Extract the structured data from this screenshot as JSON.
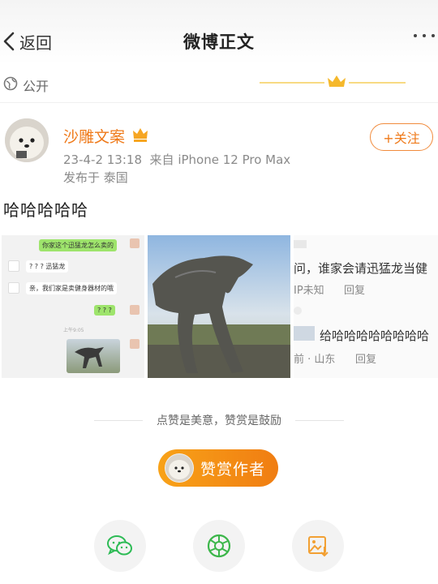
{
  "nav": {
    "back_label": "返回",
    "title": "微博正文"
  },
  "visibility": {
    "label": "公开"
  },
  "post": {
    "username": "沙雕文案",
    "timestamp": "23-4-2 13:18",
    "source": "来自 iPhone 12 Pro Max",
    "published_from": "发布于 泰国",
    "follow_label": "+关注",
    "text": "哈哈哈哈哈"
  },
  "images": {
    "chat": {
      "msg1": "你家这个迅猛龙怎么卖的",
      "msg2": "? ? ?  迅猛龙",
      "msg3": "亲，我们家是卖健身器材的哦",
      "msg4": "? ? ?",
      "time": "上午9:05"
    },
    "comments": {
      "line1": "问，谁家会请迅猛龙当健",
      "line1_meta": "IP未知",
      "line1_reply": "回复",
      "line2": "给哈哈哈哈哈哈哈哈",
      "line2_meta": "前 · 山东",
      "line2_reply": "回复"
    }
  },
  "reward": {
    "encourage_text": "点赞是美意，赞赏是鼓励",
    "button_label": "赞赏作者"
  },
  "colors": {
    "accent_orange": "#ef7a1a",
    "reward_gradient_start": "#f8a218",
    "reward_gradient_end": "#f07d12",
    "wechat_green": "#2dbb55",
    "moments_green": "#3cb64a",
    "save_orange": "#f2a033"
  },
  "icons": {
    "back": "chevron-left-icon",
    "more": "more-dots-icon",
    "visibility": "globe-icon",
    "vip": "crown-icon",
    "share_wechat": "wechat-icon",
    "share_moments": "moments-icon",
    "save_image": "save-image-icon"
  }
}
